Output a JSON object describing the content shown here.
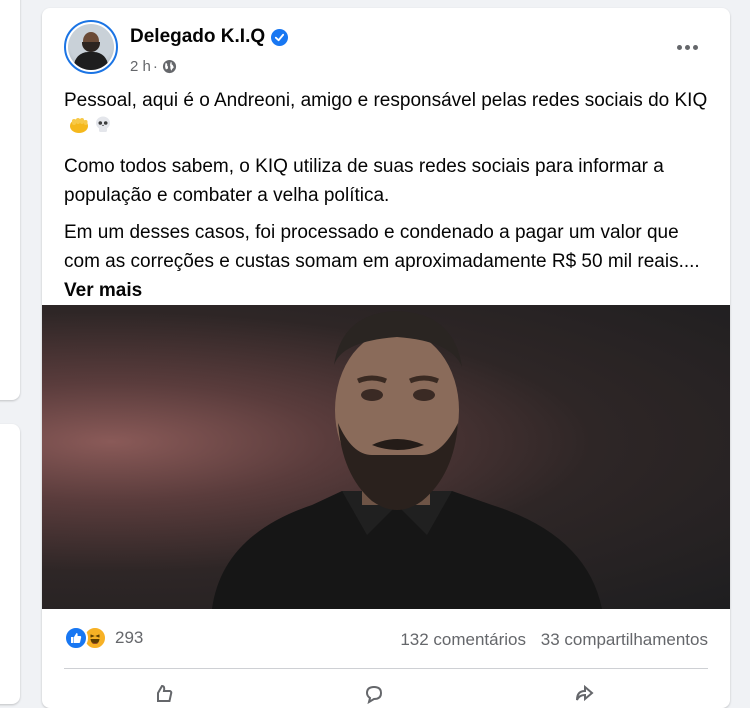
{
  "post": {
    "author": "Delegado K.I.Q",
    "verified": true,
    "time": "2 h",
    "separator": "·",
    "paragraphs": [
      "Pessoal, aqui é o Andreoni, amigo e responsável pelas redes sociais do KIQ",
      "Como todos sabem, o KIQ utiliza de suas redes sociais para informar a população e combater a velha política.",
      "Em um desses casos, foi processado e condenado a pagar um valor que com as correções e custas somam em aproximadamente R$ 50 mil reais...."
    ],
    "see_more": "Ver mais",
    "emojis": [
      "fist-emoji",
      "skull-emoji"
    ]
  },
  "stats": {
    "reactions": [
      "like",
      "haha"
    ],
    "reaction_count": "293",
    "comments": "132 comentários",
    "shares": "33 compartilhamentos"
  },
  "colors": {
    "brand": "#1877f2",
    "secondary_text": "#65676b",
    "haha": "#f7b125"
  }
}
